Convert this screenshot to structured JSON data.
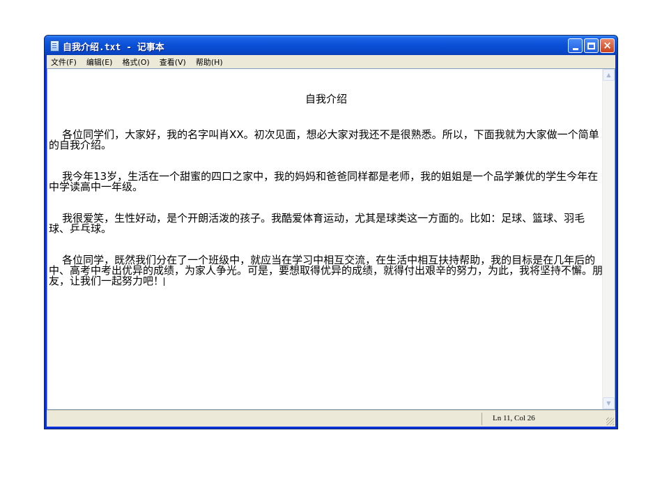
{
  "window": {
    "title": "自我介绍.txt - 记事本",
    "icon": "notepad-icon",
    "buttons": {
      "minimize": "minimize-icon",
      "maximize": "maximize-icon",
      "close": "×"
    }
  },
  "menu": [
    {
      "label": "文件(F)"
    },
    {
      "label": "编辑(E)"
    },
    {
      "label": "格式(O)"
    },
    {
      "label": "查看(V)"
    },
    {
      "label": "帮助(H)"
    }
  ],
  "document": {
    "title": "自我介绍",
    "paragraphs": [
      "各位同学们，大家好，我的名字叫肖XX。初次见面，想必大家对我还不是很熟悉。所以，下面我就为大家做一个简单的自我介绍。",
      "我今年13岁，生活在一个甜蜜的四口之家中，我的妈妈和爸爸同样都是老师，我的姐姐是一个品学兼优的学生今年在中学读高中一年级。",
      "我很爱笑，生性好动，是个开朗活泼的孩子。我酷爱体育运动，尤其是球类这一方面的。比如：足球、篮球、羽毛球、乒乓球。",
      "各位同学，既然我们分在了一个班级中，就应当在学习中相互交流，在生活中相互扶持帮助，我的目标是在几年后的中、高考中考出优异的成绩，为家人争光。可是，要想取得优异的成绩，就得付出艰辛的努力，为此，我将坚持不懈。朋友，让我们一起努力吧！"
    ]
  },
  "status": {
    "position": "Ln 11, Col 26"
  },
  "colors": {
    "titlebar": "#0a4fd6",
    "chrome": "#ece9d8",
    "close_button": "#c8421c"
  }
}
